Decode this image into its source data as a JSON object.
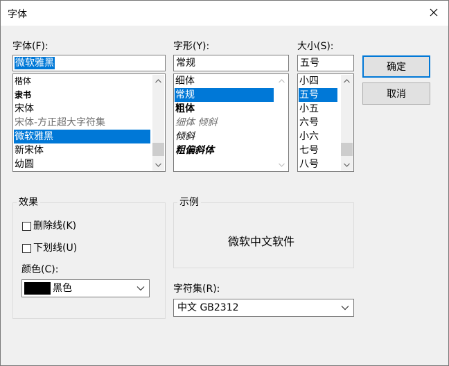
{
  "window": {
    "title": "字体"
  },
  "font": {
    "label": "字体(F):",
    "value": "微软雅黑",
    "items": [
      "楷体",
      "隶书",
      "宋体",
      "宋体-方正超大字符集",
      "微软雅黑",
      "新宋体",
      "幼圆"
    ],
    "selected_index": 4
  },
  "style": {
    "label": "字形(Y):",
    "value": "常规",
    "items": [
      "细体",
      "常规",
      "粗体",
      "细体 倾斜",
      "倾斜",
      "粗偏斜体"
    ],
    "selected_index": 1
  },
  "size": {
    "label": "大小(S):",
    "value": "五号",
    "items": [
      "小四",
      "五号",
      "小五",
      "六号",
      "小六",
      "七号",
      "八号"
    ],
    "selected_index": 1
  },
  "buttons": {
    "ok": "确定",
    "cancel": "取消"
  },
  "effects": {
    "title": "效果",
    "strikeout": {
      "label": "删除线(K)",
      "checked": false
    },
    "underline": {
      "label": "下划线(U)",
      "checked": false
    },
    "color_label": "颜色(C):",
    "color_value": "黑色",
    "color_hex": "#000000"
  },
  "sample": {
    "title": "示例",
    "text": "微软中文软件"
  },
  "charset": {
    "label": "字符集(R):",
    "value": "中文 GB2312"
  },
  "colors": {
    "accent": "#0078d7",
    "disabled_text": "#6d6d6d"
  }
}
